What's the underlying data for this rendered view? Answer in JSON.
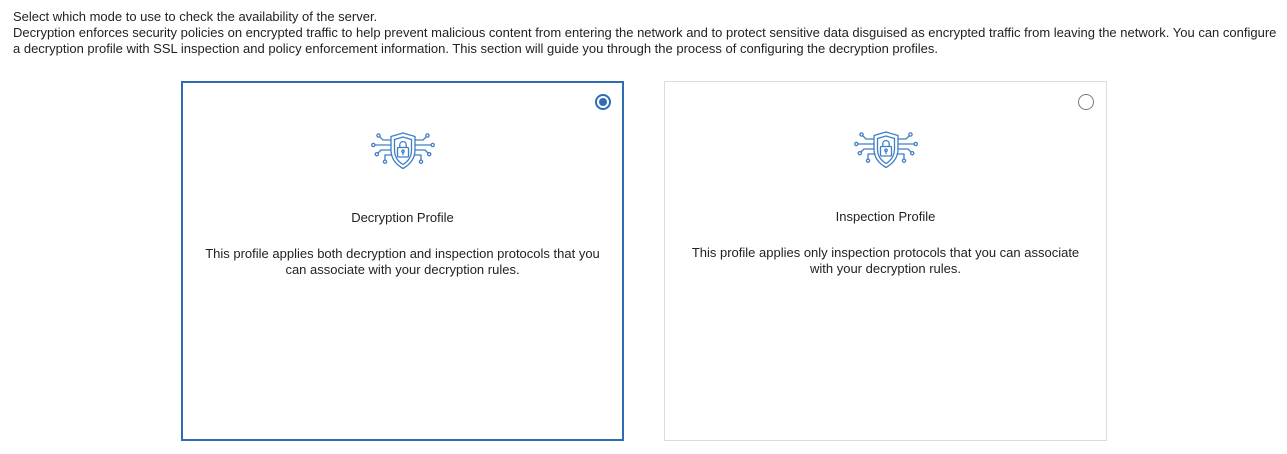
{
  "intro": {
    "line1": "Select which mode to use to check the availability of the server.",
    "line2": "Decryption enforces security policies on encrypted traffic to help prevent malicious content from entering the network and to protect sensitive data disguised as encrypted traffic from leaving the network. You can configure a decryption profile with SSL inspection and policy enforcement information. This section will guide you through the process of configuring the decryption profiles."
  },
  "colors": {
    "accent": "#2e6db5",
    "icon": "#3f7fc4"
  },
  "cards": [
    {
      "title": "Decryption Profile",
      "description": "This profile applies both decryption and inspection protocols that you can associate with your decryption rules.",
      "selected": true,
      "icon": "shield-lock-circuit-icon"
    },
    {
      "title": "Inspection Profile",
      "description": "This profile applies only inspection protocols that you can associate with your decryption rules.",
      "selected": false,
      "icon": "shield-lock-circuit-icon"
    }
  ]
}
